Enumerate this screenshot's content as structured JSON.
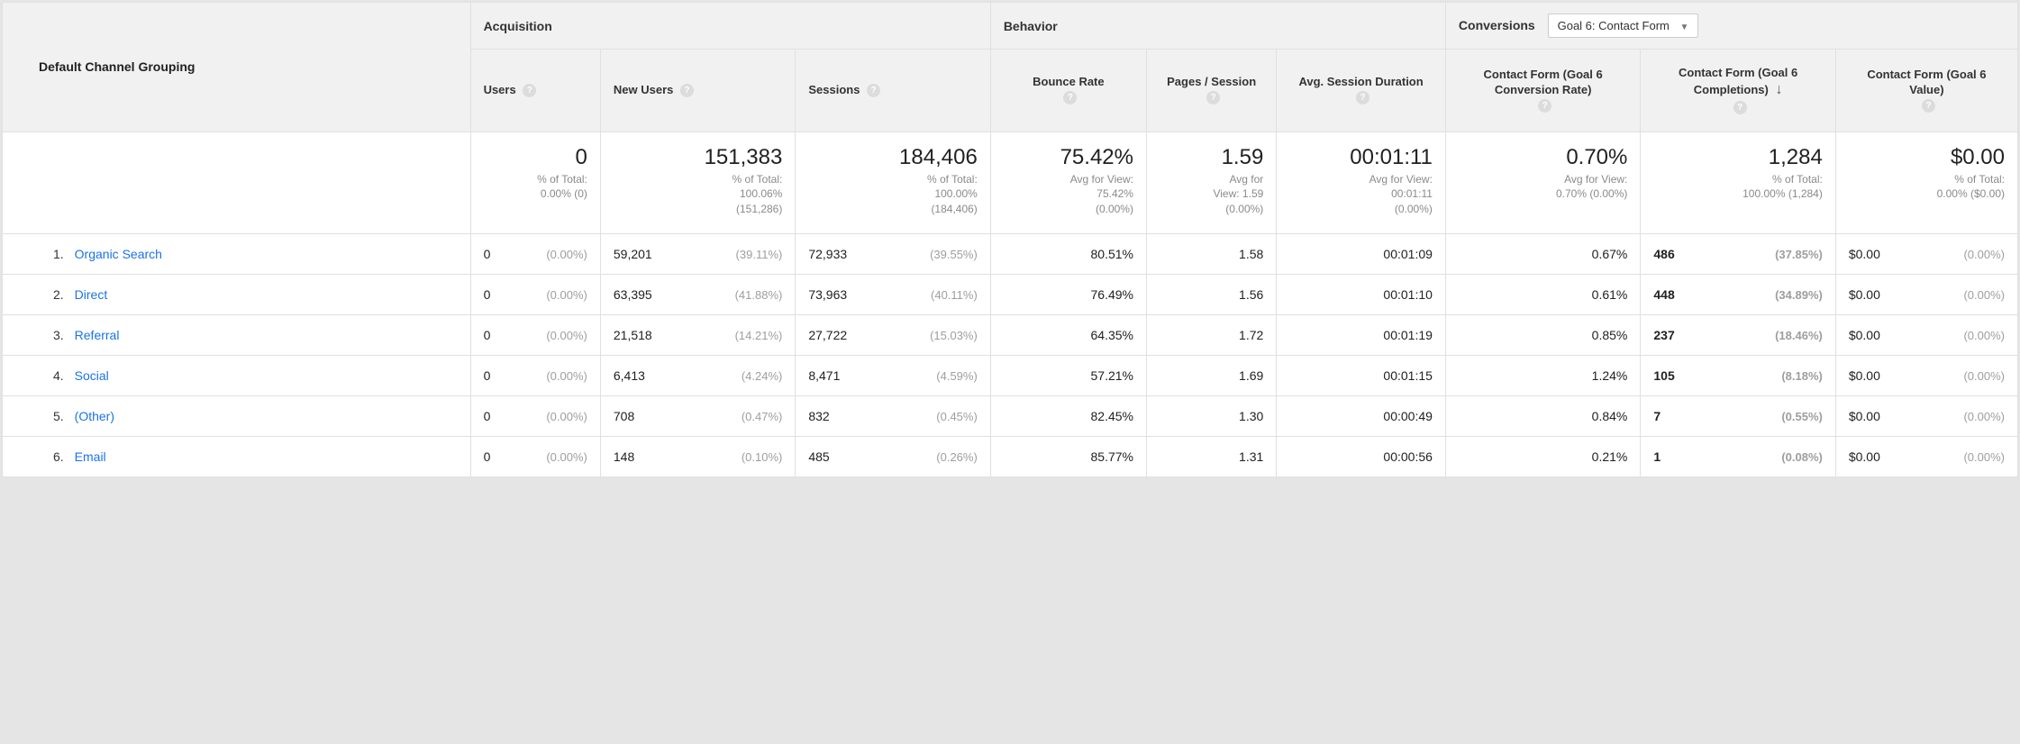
{
  "dimension_label": "Default Channel Grouping",
  "groups": {
    "acquisition": "Acquisition",
    "behavior": "Behavior",
    "conversions": "Conversions"
  },
  "goal_selector": "Goal 6: Contact Form",
  "columns": {
    "users": "Users",
    "new_users": "New Users",
    "sessions": "Sessions",
    "bounce_rate": "Bounce Rate",
    "pages_session": "Pages / Session",
    "avg_session_duration": "Avg. Session Duration",
    "conv_rate": "Contact Form (Goal 6 Conversion Rate)",
    "completions": "Contact Form (Goal 6 Completions)",
    "value": "Contact Form (Goal 6 Value)"
  },
  "summary": {
    "users": {
      "big": "0",
      "sub1": "% of Total:",
      "sub2": "0.00% (0)"
    },
    "new_users": {
      "big": "151,383",
      "sub1": "% of Total:",
      "sub2": "100.06%",
      "sub3": "(151,286)"
    },
    "sessions": {
      "big": "184,406",
      "sub1": "% of Total:",
      "sub2": "100.00%",
      "sub3": "(184,406)"
    },
    "bounce_rate": {
      "big": "75.42%",
      "sub1": "Avg for View:",
      "sub2": "75.42%",
      "sub3": "(0.00%)"
    },
    "pages_session": {
      "big": "1.59",
      "sub1": "Avg for",
      "sub2": "View: 1.59",
      "sub3": "(0.00%)"
    },
    "avg_session_duration": {
      "big": "00:01:11",
      "sub1": "Avg for View:",
      "sub2": "00:01:11",
      "sub3": "(0.00%)"
    },
    "conv_rate": {
      "big": "0.70%",
      "sub1": "Avg for View:",
      "sub2": "0.70% (0.00%)"
    },
    "completions": {
      "big": "1,284",
      "sub1": "% of Total:",
      "sub2": "100.00% (1,284)"
    },
    "value": {
      "big": "$0.00",
      "sub1": "% of Total:",
      "sub2": "0.00% ($0.00)"
    }
  },
  "rows": [
    {
      "idx": "1.",
      "name": "Organic Search",
      "users_v": "0",
      "users_p": "(0.00%)",
      "new_v": "59,201",
      "new_p": "(39.11%)",
      "sess_v": "72,933",
      "sess_p": "(39.55%)",
      "br": "80.51%",
      "pps": "1.58",
      "asd": "00:01:09",
      "cr": "0.67%",
      "comp_v": "486",
      "comp_p": "(37.85%)",
      "val_v": "$0.00",
      "val_p": "(0.00%)"
    },
    {
      "idx": "2.",
      "name": "Direct",
      "users_v": "0",
      "users_p": "(0.00%)",
      "new_v": "63,395",
      "new_p": "(41.88%)",
      "sess_v": "73,963",
      "sess_p": "(40.11%)",
      "br": "76.49%",
      "pps": "1.56",
      "asd": "00:01:10",
      "cr": "0.61%",
      "comp_v": "448",
      "comp_p": "(34.89%)",
      "val_v": "$0.00",
      "val_p": "(0.00%)"
    },
    {
      "idx": "3.",
      "name": "Referral",
      "users_v": "0",
      "users_p": "(0.00%)",
      "new_v": "21,518",
      "new_p": "(14.21%)",
      "sess_v": "27,722",
      "sess_p": "(15.03%)",
      "br": "64.35%",
      "pps": "1.72",
      "asd": "00:01:19",
      "cr": "0.85%",
      "comp_v": "237",
      "comp_p": "(18.46%)",
      "val_v": "$0.00",
      "val_p": "(0.00%)"
    },
    {
      "idx": "4.",
      "name": "Social",
      "users_v": "0",
      "users_p": "(0.00%)",
      "new_v": "6,413",
      "new_p": "(4.24%)",
      "sess_v": "8,471",
      "sess_p": "(4.59%)",
      "br": "57.21%",
      "pps": "1.69",
      "asd": "00:01:15",
      "cr": "1.24%",
      "comp_v": "105",
      "comp_p": "(8.18%)",
      "val_v": "$0.00",
      "val_p": "(0.00%)"
    },
    {
      "idx": "5.",
      "name": "(Other)",
      "users_v": "0",
      "users_p": "(0.00%)",
      "new_v": "708",
      "new_p": "(0.47%)",
      "sess_v": "832",
      "sess_p": "(0.45%)",
      "br": "82.45%",
      "pps": "1.30",
      "asd": "00:00:49",
      "cr": "0.84%",
      "comp_v": "7",
      "comp_p": "(0.55%)",
      "val_v": "$0.00",
      "val_p": "(0.00%)"
    },
    {
      "idx": "6.",
      "name": "Email",
      "users_v": "0",
      "users_p": "(0.00%)",
      "new_v": "148",
      "new_p": "(0.10%)",
      "sess_v": "485",
      "sess_p": "(0.26%)",
      "br": "85.77%",
      "pps": "1.31",
      "asd": "00:00:56",
      "cr": "0.21%",
      "comp_v": "1",
      "comp_p": "(0.08%)",
      "val_v": "$0.00",
      "val_p": "(0.00%)"
    }
  ]
}
